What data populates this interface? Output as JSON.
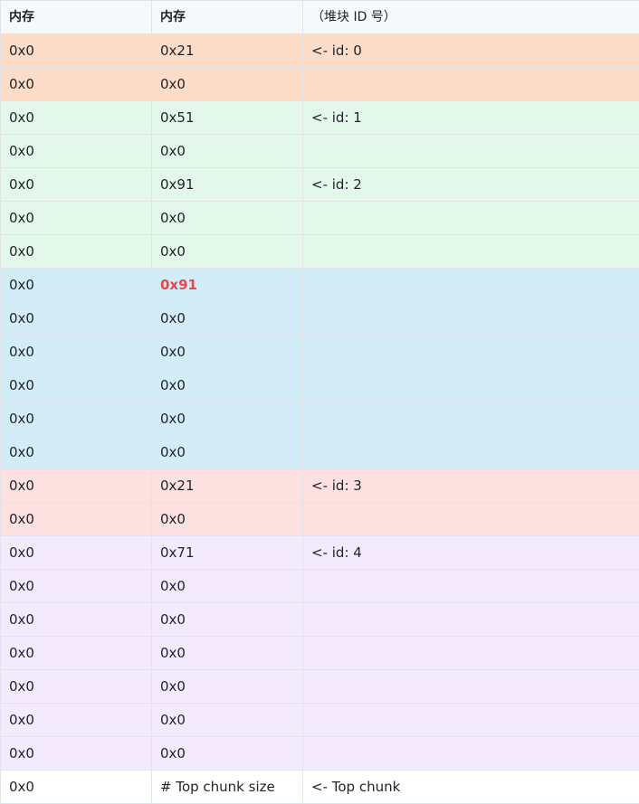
{
  "header": {
    "col1": "内存",
    "col2": "内存",
    "col3": "（堆块 ID 号）"
  },
  "colors": {
    "orange": "#fddcc8",
    "green": "#e3f8ea",
    "blue": "#d3edf8",
    "pink": "#fde0e0",
    "purple": "#f3eafd",
    "white": "#ffffff",
    "highlight_text": "#e5484d"
  },
  "rows": [
    {
      "c1": "0x0",
      "c2": "0x21",
      "c3": "<- id: 0",
      "bg": "orange"
    },
    {
      "c1": "0x0",
      "c2": "0x0",
      "c3": "",
      "bg": "orange"
    },
    {
      "c1": "0x0",
      "c2": "0x51",
      "c3": "<- id: 1",
      "bg": "green"
    },
    {
      "c1": "0x0",
      "c2": "0x0",
      "c3": "",
      "bg": "green"
    },
    {
      "c1": "0x0",
      "c2": "0x91",
      "c3": "<- id: 2",
      "bg": "green"
    },
    {
      "c1": "0x0",
      "c2": "0x0",
      "c3": "",
      "bg": "green"
    },
    {
      "c1": "0x0",
      "c2": "0x0",
      "c3": "",
      "bg": "green"
    },
    {
      "c1": "0x0",
      "c2": "0x91",
      "c3": "",
      "bg": "blue",
      "highlight": true
    },
    {
      "c1": "0x0",
      "c2": "0x0",
      "c3": "",
      "bg": "blue"
    },
    {
      "c1": "0x0",
      "c2": "0x0",
      "c3": "",
      "bg": "blue"
    },
    {
      "c1": "0x0",
      "c2": "0x0",
      "c3": "",
      "bg": "blue"
    },
    {
      "c1": "0x0",
      "c2": "0x0",
      "c3": "",
      "bg": "blue"
    },
    {
      "c1": "0x0",
      "c2": "0x0",
      "c3": "",
      "bg": "blue"
    },
    {
      "c1": "0x0",
      "c2": "0x21",
      "c3": "<- id: 3",
      "bg": "pink"
    },
    {
      "c1": "0x0",
      "c2": "0x0",
      "c3": "",
      "bg": "pink"
    },
    {
      "c1": "0x0",
      "c2": "0x71",
      "c3": "<- id: 4",
      "bg": "purple"
    },
    {
      "c1": "0x0",
      "c2": "0x0",
      "c3": "",
      "bg": "purple"
    },
    {
      "c1": "0x0",
      "c2": "0x0",
      "c3": "",
      "bg": "purple"
    },
    {
      "c1": "0x0",
      "c2": "0x0",
      "c3": "",
      "bg": "purple"
    },
    {
      "c1": "0x0",
      "c2": "0x0",
      "c3": "",
      "bg": "purple"
    },
    {
      "c1": "0x0",
      "c2": "0x0",
      "c3": "",
      "bg": "purple"
    },
    {
      "c1": "0x0",
      "c2": "0x0",
      "c3": "",
      "bg": "purple"
    },
    {
      "c1": "0x0",
      "c2": "# Top chunk size",
      "c3": "<- Top chunk",
      "bg": "white"
    }
  ]
}
